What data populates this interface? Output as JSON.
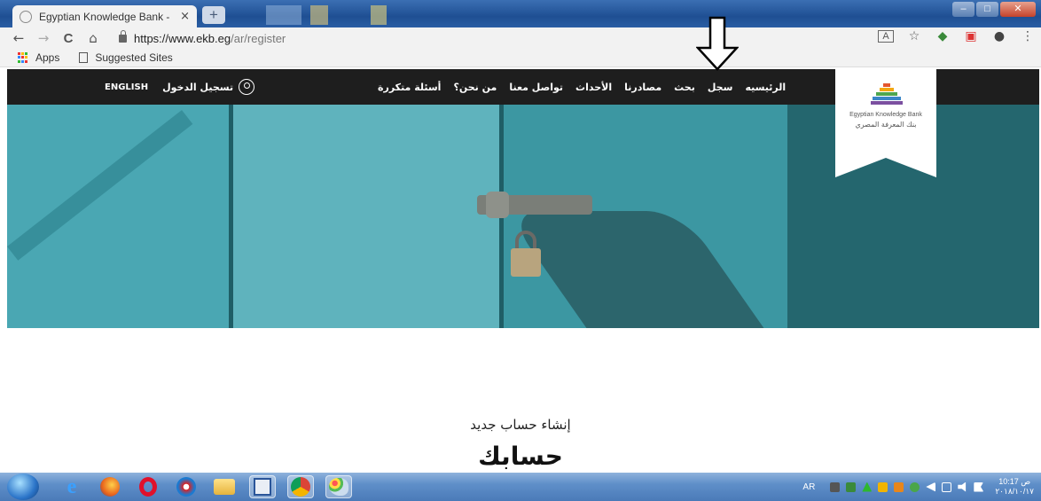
{
  "browser": {
    "tab_title": "Egyptian Knowledge Bank - Regi",
    "tab_close": "×",
    "new_tab": "+",
    "url_host": "https://www.ekb.eg",
    "url_path": "/ar/register",
    "back": "←",
    "forward": "→",
    "reload": "C",
    "home": "⌂",
    "bookmarks": [
      {
        "label": "Apps",
        "icon": "apps-icon"
      },
      {
        "label": "Suggested Sites",
        "icon": "page-icon"
      }
    ],
    "toolbar_icons": [
      "translate-icon",
      "star-icon",
      "extension-icon",
      "pocket-icon",
      "profile-icon",
      "menu-icon"
    ]
  },
  "site": {
    "nav_links": [
      "الرئيسيه",
      "سجل",
      "بحث",
      "مصادرنا",
      "الأحداث",
      "تواصل معنا",
      "من نحن؟",
      "أسئلة متكررة"
    ],
    "login_label": "تسجيل الدخول",
    "language_toggle": "ENGLISH",
    "logo_en": "Egyptian Knowledge Bank",
    "logo_ar": "بنك المعرفة المصري"
  },
  "content": {
    "subtitle": "إنشاء حساب جديد",
    "title": "حسابك"
  },
  "taskbar": {
    "language": "AR",
    "clock_time": "10:17 ص",
    "clock_date": "٢٠١٨/١٠/١٧",
    "apps": [
      "start-button",
      "ie-icon",
      "firefox-icon",
      "opera-icon",
      "skype-icon",
      "explorer-icon",
      "word-icon",
      "chrome-icon",
      "paint-icon"
    ]
  },
  "colors": {
    "nav_bg": "#1e1e1e",
    "hero_teal": "#3c9aa6",
    "taskbar_blue": "#5f8fc9"
  }
}
